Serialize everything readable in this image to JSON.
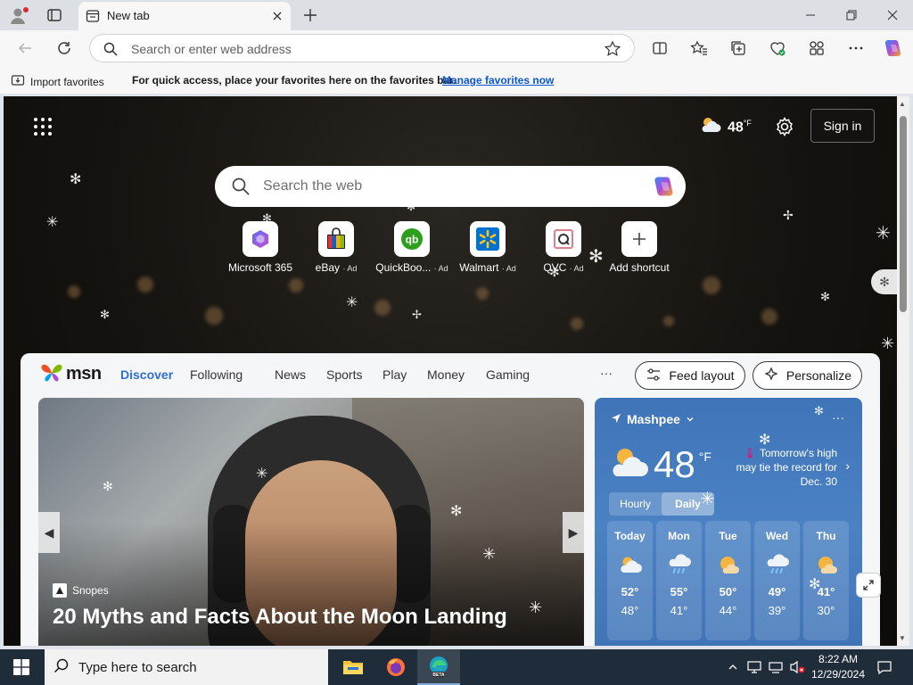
{
  "tab": {
    "title": "New tab"
  },
  "address_bar": {
    "placeholder": "Search or enter web address"
  },
  "favorites_bar": {
    "import_label": "Import favorites",
    "message": "For quick access, place your favorites here on the favorites bar.",
    "manage_link": "Manage favorites now"
  },
  "header": {
    "weather_temp": "48",
    "weather_unit": "°F",
    "sign_in_label": "Sign in"
  },
  "web_search": {
    "placeholder": "Search the web"
  },
  "shortcuts": [
    {
      "label": "Microsoft 365",
      "ad": ""
    },
    {
      "label": "eBay",
      "ad": "· Ad"
    },
    {
      "label": "QuickBoo...",
      "ad": "· Ad"
    },
    {
      "label": "Walmart",
      "ad": "· Ad"
    },
    {
      "label": "QVC",
      "ad": "· Ad"
    },
    {
      "label": "Add shortcut",
      "ad": ""
    }
  ],
  "feed": {
    "logo_text": "msn",
    "nav": [
      "Discover",
      "Following",
      "News",
      "Sports",
      "Play",
      "Money",
      "Gaming"
    ],
    "more": "···",
    "feed_layout_label": "Feed layout",
    "personalize_label": "Personalize"
  },
  "hero": {
    "source": "Snopes",
    "headline": "20 Myths and Facts About the Moon Landing"
  },
  "weather_card": {
    "location": "Mashpee",
    "more": "···",
    "temp": "48",
    "unit": "°F",
    "note": "Tomorrow's high may tie the record for Dec. 30",
    "tabs": [
      "Hourly",
      "Daily"
    ],
    "days": [
      {
        "name": "Today",
        "hi": "52°",
        "lo": "48°",
        "icon": "partly-cloudy-icon"
      },
      {
        "name": "Mon",
        "hi": "55°",
        "lo": "41°",
        "icon": "rain-icon"
      },
      {
        "name": "Tue",
        "hi": "50°",
        "lo": "44°",
        "icon": "sun-cloud-icon"
      },
      {
        "name": "Wed",
        "hi": "49°",
        "lo": "39°",
        "icon": "rain-icon"
      },
      {
        "name": "Thu",
        "hi": "41°",
        "lo": "30°",
        "icon": "sun-cloud-icon"
      }
    ]
  },
  "taskbar": {
    "search_placeholder": "Type here to search",
    "time": "8:22 AM",
    "date": "12/29/2024"
  },
  "colors": {
    "accent": "#2f6fd4",
    "page_bg": "#15130f",
    "weather_card": "#4b82c4",
    "taskbar": "#1f2d3a"
  }
}
